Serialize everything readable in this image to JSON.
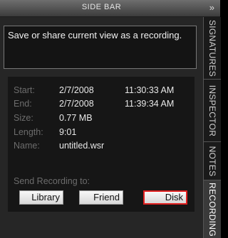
{
  "titlebar": {
    "title": "SIDE BAR",
    "collapse_glyph": "»"
  },
  "description": "Save or share current view as a recording.",
  "recording": {
    "start_label": "Start:",
    "start_date": "2/7/2008",
    "start_time": "11:30:33 AM",
    "end_label": "End:",
    "end_date": "2/7/2008",
    "end_time": "11:39:34 AM",
    "size_label": "Size:",
    "size_value": "0.77 MB",
    "length_label": "Length:",
    "length_value": "9:01",
    "name_label": "Name:",
    "name_value": "untitled.wsr"
  },
  "send": {
    "label": "Send Recording to:",
    "library": "Library",
    "friend": "Friend",
    "disk": "Disk",
    "selected": "Disk",
    "selected_color": "#e02020"
  },
  "tabs": [
    "SIGNATURES",
    "INSPECTOR",
    "NOTES",
    "RECORDING"
  ],
  "active_tab": "RECORDING"
}
